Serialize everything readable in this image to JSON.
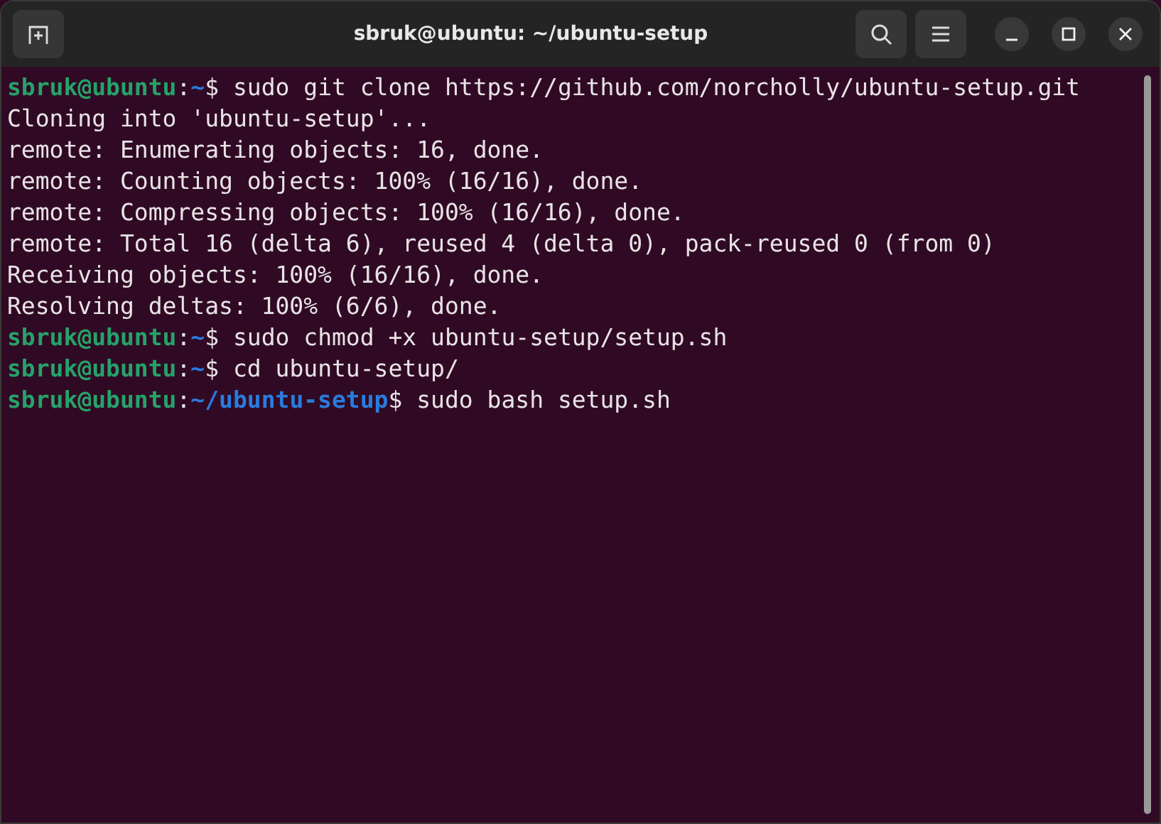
{
  "window": {
    "title": "sbruk@ubuntu: ~/ubuntu-setup"
  },
  "terminal": {
    "lines": [
      {
        "kind": "prompt",
        "user": "sbruk@ubuntu",
        "separator": ":",
        "path": "~",
        "symbol": "$",
        "command": "sudo git clone https://github.com/norcholly/ubuntu-setup.git"
      },
      {
        "kind": "output",
        "text": "Cloning into 'ubuntu-setup'..."
      },
      {
        "kind": "output",
        "text": "remote: Enumerating objects: 16, done."
      },
      {
        "kind": "output",
        "text": "remote: Counting objects: 100% (16/16), done."
      },
      {
        "kind": "output",
        "text": "remote: Compressing objects: 100% (16/16), done."
      },
      {
        "kind": "output",
        "text": "remote: Total 16 (delta 6), reused 4 (delta 0), pack-reused 0 (from 0)"
      },
      {
        "kind": "output",
        "text": "Receiving objects: 100% (16/16), done."
      },
      {
        "kind": "output",
        "text": "Resolving deltas: 100% (6/6), done."
      },
      {
        "kind": "prompt",
        "user": "sbruk@ubuntu",
        "separator": ":",
        "path": "~",
        "symbol": "$",
        "command": "sudo chmod +x ubuntu-setup/setup.sh"
      },
      {
        "kind": "prompt",
        "user": "sbruk@ubuntu",
        "separator": ":",
        "path": "~",
        "symbol": "$",
        "command": "cd ubuntu-setup/"
      },
      {
        "kind": "prompt",
        "user": "sbruk@ubuntu",
        "separator": ":",
        "path": "~/ubuntu-setup",
        "symbol": "$",
        "command": "sudo bash setup.sh"
      }
    ]
  }
}
